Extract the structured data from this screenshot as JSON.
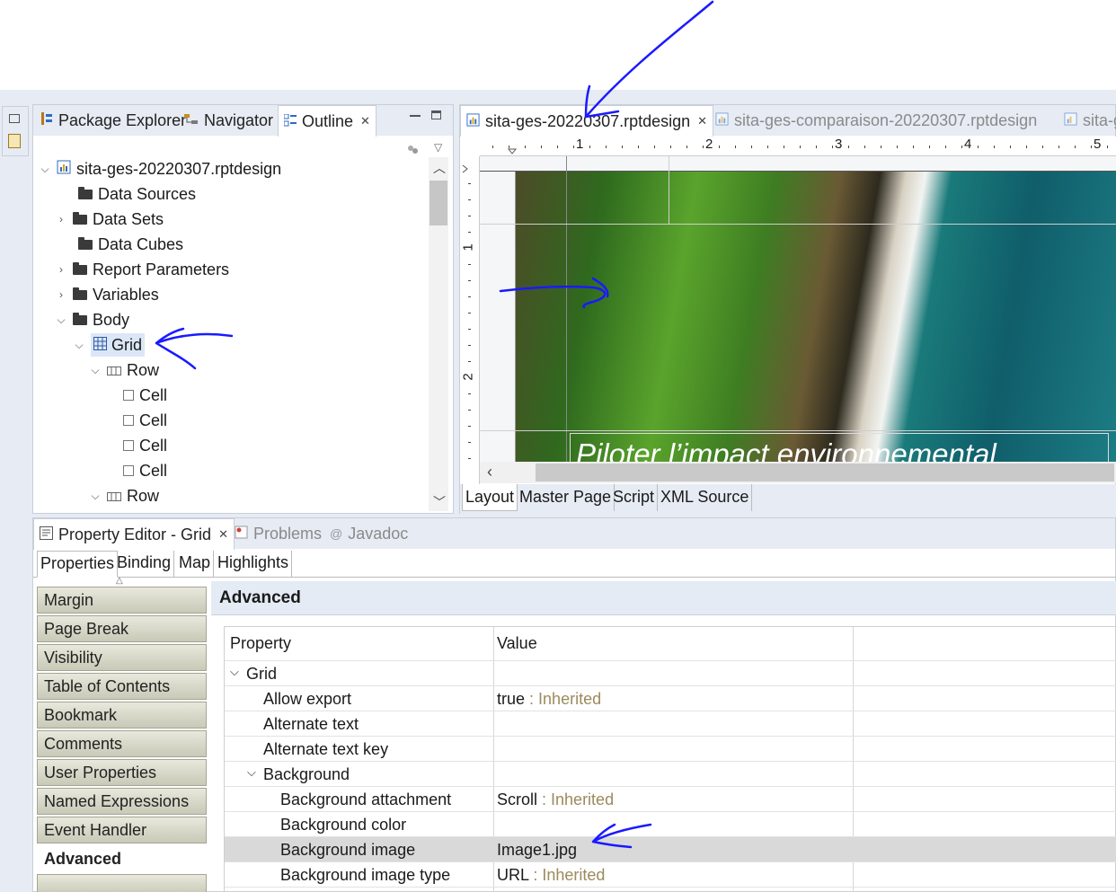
{
  "outline": {
    "tabs": [
      {
        "label": "Package Explorer"
      },
      {
        "label": "Navigator"
      },
      {
        "label": "Outline"
      }
    ],
    "tree": [
      {
        "label": "sita-ges-20220307.rptdesign"
      },
      {
        "label": "Data Sources"
      },
      {
        "label": "Data Sets"
      },
      {
        "label": "Data Cubes"
      },
      {
        "label": "Report Parameters"
      },
      {
        "label": "Variables"
      },
      {
        "label": "Body"
      },
      {
        "label": "Grid"
      },
      {
        "label": "Row"
      },
      {
        "label": "Cell"
      },
      {
        "label": "Cell"
      },
      {
        "label": "Cell"
      },
      {
        "label": "Cell"
      },
      {
        "label": "Row"
      }
    ]
  },
  "editor": {
    "tabs": [
      {
        "label": "sita-ges-20220307.rptdesign"
      },
      {
        "label": "sita-ges-comparaison-20220307.rptdesign"
      },
      {
        "label": "sita-g"
      }
    ],
    "ruler_numbers": [
      "1",
      "2",
      "3",
      "4",
      "5"
    ],
    "vruler_numbers": [
      "1",
      "2"
    ],
    "overlay_text": "Piloter l’impact environnemental",
    "bottom_tabs": [
      {
        "label": "Layout"
      },
      {
        "label": "Master Page"
      },
      {
        "label": "Script"
      },
      {
        "label": "XML Source"
      }
    ]
  },
  "properties": {
    "tabs": [
      {
        "label": "Property Editor - Grid"
      },
      {
        "label": "Problems"
      },
      {
        "label": "Javadoc"
      }
    ],
    "subtabs": [
      {
        "label": "Properties"
      },
      {
        "label": "Binding"
      },
      {
        "label": "Map"
      },
      {
        "label": "Highlights"
      }
    ],
    "categories": [
      {
        "label": "Margin"
      },
      {
        "label": "Page Break"
      },
      {
        "label": "Visibility"
      },
      {
        "label": "Table of Contents"
      },
      {
        "label": "Bookmark"
      },
      {
        "label": "Comments"
      },
      {
        "label": "User Properties"
      },
      {
        "label": "Named Expressions"
      },
      {
        "label": "Event Handler"
      },
      {
        "label": "Advanced"
      }
    ],
    "section_title": "Advanced",
    "table_header": {
      "property": "Property",
      "value": "Value"
    },
    "rows": [
      {
        "name": "Grid",
        "value": "",
        "inherited": ""
      },
      {
        "name": "Allow export",
        "value": "true",
        "inherited": ": Inherited"
      },
      {
        "name": "Alternate text",
        "value": "",
        "inherited": ""
      },
      {
        "name": "Alternate text key",
        "value": "",
        "inherited": ""
      },
      {
        "name": "Background",
        "value": "",
        "inherited": ""
      },
      {
        "name": "Background attachment",
        "value": "Scroll",
        "inherited": ": Inherited"
      },
      {
        "name": "Background color",
        "value": "",
        "inherited": ""
      },
      {
        "name": "Background image",
        "value": "Image1.jpg",
        "inherited": ""
      },
      {
        "name": "Background image type",
        "value": "URL",
        "inherited": ": Inherited"
      }
    ]
  },
  "colors": {
    "annotation": "#1a1aff",
    "inherited_text": "#9c8a5c",
    "selection": "#d9d9d9",
    "workbench_bg": "#e6ebf4"
  }
}
